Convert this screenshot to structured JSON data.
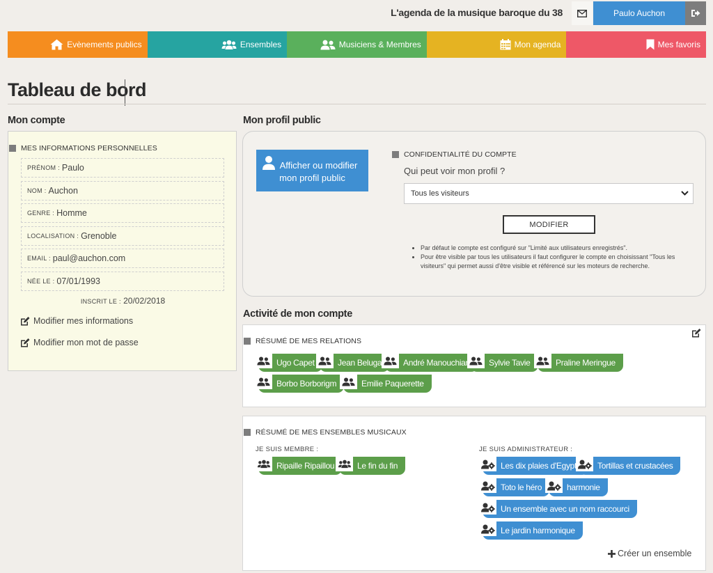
{
  "header": {
    "site_title": "L'agenda de la musique baroque du 38",
    "user_name": "Paulo Auchon"
  },
  "nav": [
    {
      "label": "Evènements publics",
      "color": "#f58d1f",
      "icon": "home-icon"
    },
    {
      "label": "Ensembles",
      "color": "#26a4a1",
      "icon": "users-icon"
    },
    {
      "label": "Musiciens & Membres",
      "color": "#5ab05c",
      "icon": "user-group-icon"
    },
    {
      "label": "Mon agenda",
      "color": "#e5b322",
      "icon": "calendar-icon"
    },
    {
      "label": "Mes favoris",
      "color": "#ee5867",
      "icon": "bookmark-icon"
    }
  ],
  "page_title": "Tableau de bord",
  "account": {
    "heading": "Mon compte",
    "box_label": "MES INFORMATIONS PERSONNELLES",
    "fields": [
      {
        "label": "PRÉNOM :",
        "value": "Paulo"
      },
      {
        "label": "NOM :",
        "value": "Auchon"
      },
      {
        "label": "GENRE :",
        "value": "Homme"
      },
      {
        "label": "LOCALISATION :",
        "value": "Grenoble"
      },
      {
        "label": "EMAIL :",
        "value": "paul@auchon.com"
      },
      {
        "label": "NÉE LE :",
        "value": "07/01/1993"
      }
    ],
    "registered_label": "INSCRIT LE :",
    "registered_value": "20/02/2018",
    "edit_info": "Modifier mes informations",
    "edit_password": "Modifier mon mot de passe"
  },
  "profile": {
    "heading": "Mon profil public",
    "button_line1": "Afficher ou modifier",
    "button_line2": "mon profil public",
    "privacy_label": "CONFIDENTIALITÉ DU COMPTE",
    "question": "Qui peut voir mon profil ?",
    "selected_option": "Tous les visiteurs",
    "modify_button": "MODIFIER",
    "notes": [
      "Par défaut le compte est configuré sur \"Limité aux utilisateurs enregistrés\".",
      "Pour être visible par tous les utilisateurs il faut configurer le compte en choisissant \"Tous les visiteurs\" qui permet aussi d'être visible et référencé sur les moteurs de recherche."
    ]
  },
  "activity": {
    "heading": "Activité de mon compte",
    "relations_label": "RÉSUMÉ DE MES RELATIONS",
    "relations": [
      "Ugo Capet",
      "Jean Beluga",
      "André Manouchian",
      "Sylvie Tavie",
      "Praline Meringue",
      "Borbo Borborigm",
      "Emilie Paquerette"
    ],
    "ensembles_label": "RÉSUMÉ DE MES ENSEMBLES MUSICAUX",
    "member_label": "JE SUIS MEMBRE :",
    "member_of": [
      "Ripaille Ripaillou",
      "Le fin du fin"
    ],
    "admin_label": "JE SUIS ADMINISTRATEUR :",
    "admin_of": [
      "Les dix plaies d'Egypte",
      "Tortillas et crustacées",
      "Toto le héro",
      "harmonie",
      "Un ensemble avec un nom raccourci",
      "Le jardin harmonique"
    ],
    "create_ensemble": "Créer un ensemble"
  }
}
